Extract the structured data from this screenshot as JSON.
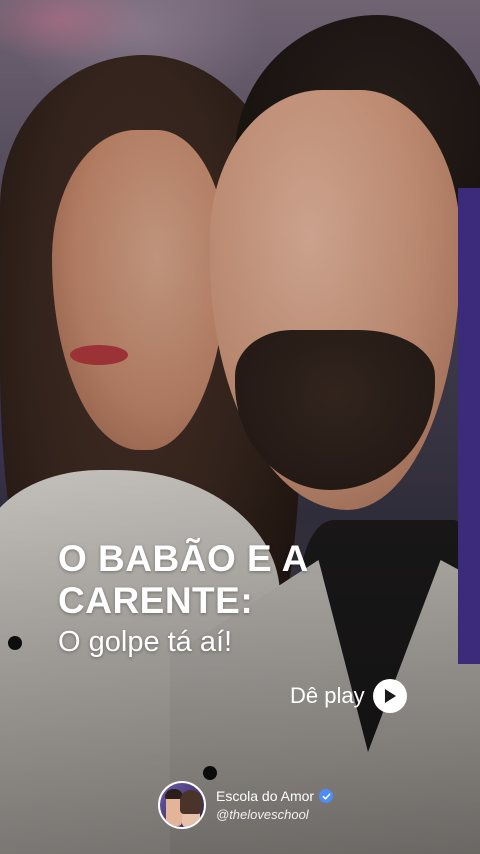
{
  "headline": {
    "line1": "O BABÃO E A",
    "line2": "CARENTE:"
  },
  "subtitle": "O golpe tá aí!",
  "cta": {
    "label": "Dê play",
    "icon": "play-icon"
  },
  "profile": {
    "name": "Escola do Amor",
    "handle": "@theloveschool",
    "verified_icon": "verified-badge-icon"
  },
  "colors": {
    "accent_bar": "#3c2b7a",
    "verified": "#4c8df6",
    "text": "#ffffff"
  }
}
